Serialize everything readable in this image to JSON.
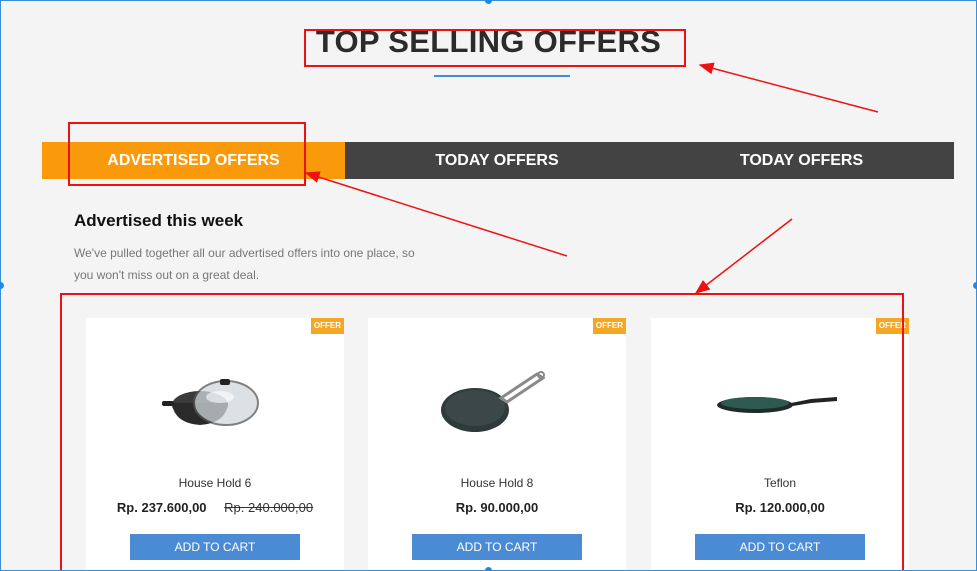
{
  "page_title": "TOP SELLING OFFERS",
  "tabs": [
    {
      "label": "ADVERTISED OFFERS"
    },
    {
      "label": "TODAY OFFERS"
    },
    {
      "label": "TODAY OFFERS"
    }
  ],
  "section": {
    "title": "Advertised this week",
    "description": "We've pulled together all our advertised offers into one place, so you won't miss out on a great deal."
  },
  "products": [
    {
      "badge": "OFFER",
      "name": "House Hold 6",
      "price": "Rp. 237.600,00",
      "old_price": "Rp. 240.000,00",
      "button": "ADD TO CART",
      "image_icon": "kadai-pot-icon"
    },
    {
      "badge": "OFFER",
      "name": "House Hold 8",
      "price": "Rp. 90.000,00",
      "old_price": "",
      "button": "ADD TO CART",
      "image_icon": "tawa-pan-icon"
    },
    {
      "badge": "OFFER",
      "name": "Teflon",
      "price": "Rp. 120.000,00",
      "old_price": "",
      "button": "ADD TO CART",
      "image_icon": "flat-pan-icon"
    }
  ],
  "colors": {
    "accent": "#fa9a0a",
    "tab_bar": "#434343",
    "button": "#4a8bd4",
    "badge": "#f4a625",
    "annotation": "#e11111"
  }
}
